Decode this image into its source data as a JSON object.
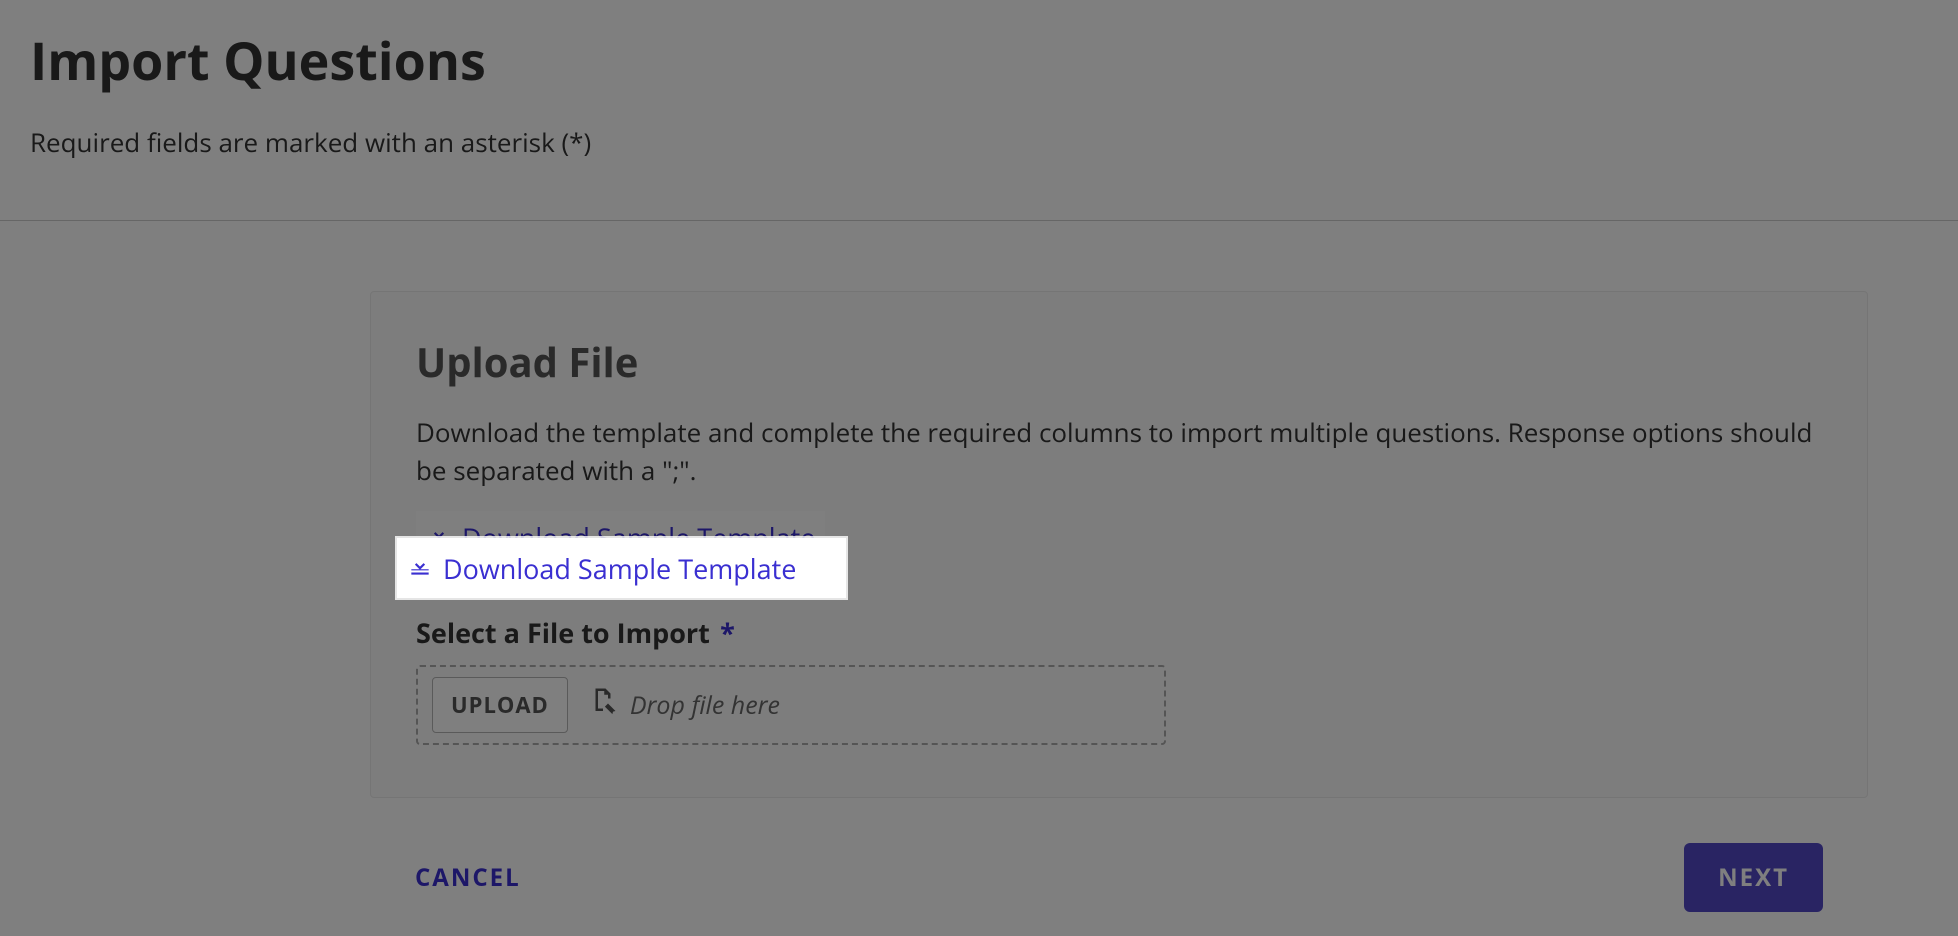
{
  "header": {
    "title": "Import Questions",
    "required_note": "Required fields are marked with an asterisk (*)"
  },
  "upload": {
    "heading": "Upload File",
    "description": "Download the template and complete the required columns to import multiple questions. Response options should be separated with a \";\".",
    "download_link_label": "Download Sample Template",
    "field_label": "Select a File to Import",
    "asterisk": "*",
    "upload_button": "UPLOAD",
    "drop_hint": "Drop file here"
  },
  "footer": {
    "cancel": "CANCEL",
    "next": "NEXT"
  }
}
